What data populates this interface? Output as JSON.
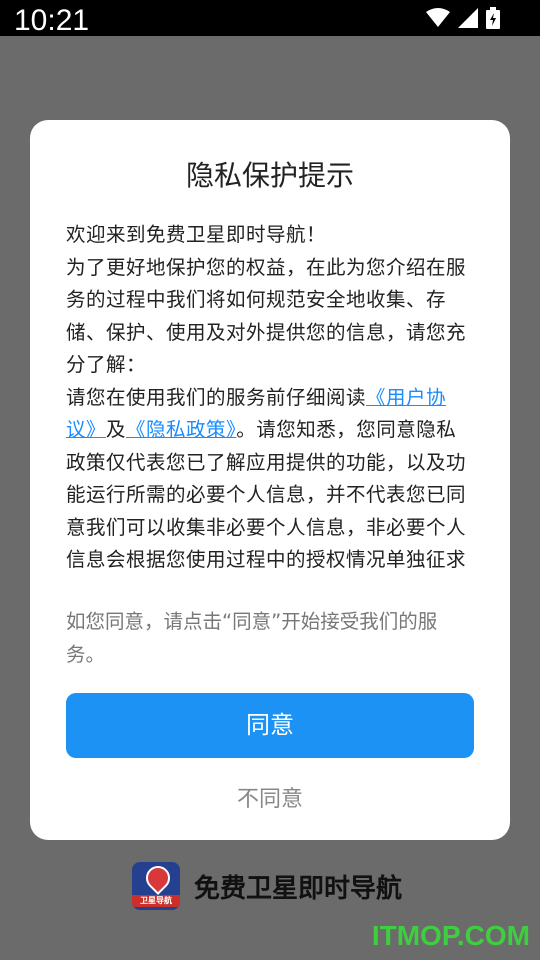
{
  "status_bar": {
    "time": "10:21",
    "icons": [
      "wifi-icon",
      "cell-signal-icon",
      "battery-charging-icon"
    ]
  },
  "dialog": {
    "title": "隐私保护提示",
    "line_welcome": "欢迎来到免费卫星即时导航！",
    "line_intro": "为了更好地保护您的权益，在此为您介绍在服务的过程中我们将如何规范安全地收集、存储、保护、使用及对外提供您的信息，请您充分了解：",
    "line_read_prefix": "请您在使用我们的服务前仔细阅读",
    "link_user_agreement": "《用户协议》",
    "and_text": "及",
    "link_privacy_policy": "《隐私政策》",
    "line_read_suffix": "。请您知悉，您同意隐私政策仅代表您已了解应用提供的功能，以及功能运行所需的必要个人信息，并不代表您已同意我们可以收集非必要个人信息，非必要个人信息会根据您使用过程中的授权情况单独征求",
    "note": "如您同意，请点击“同意”开始接受我们的服务。",
    "agree_label": "同意",
    "disagree_label": "不同意"
  },
  "app": {
    "logo_text": "卫星导航",
    "name": "免费卫星即时导航"
  },
  "watermark": "ITMOP.COM",
  "colors": {
    "accent": "#1c92f5",
    "overlay": "#6b6b6b",
    "link": "#1a8cff"
  }
}
